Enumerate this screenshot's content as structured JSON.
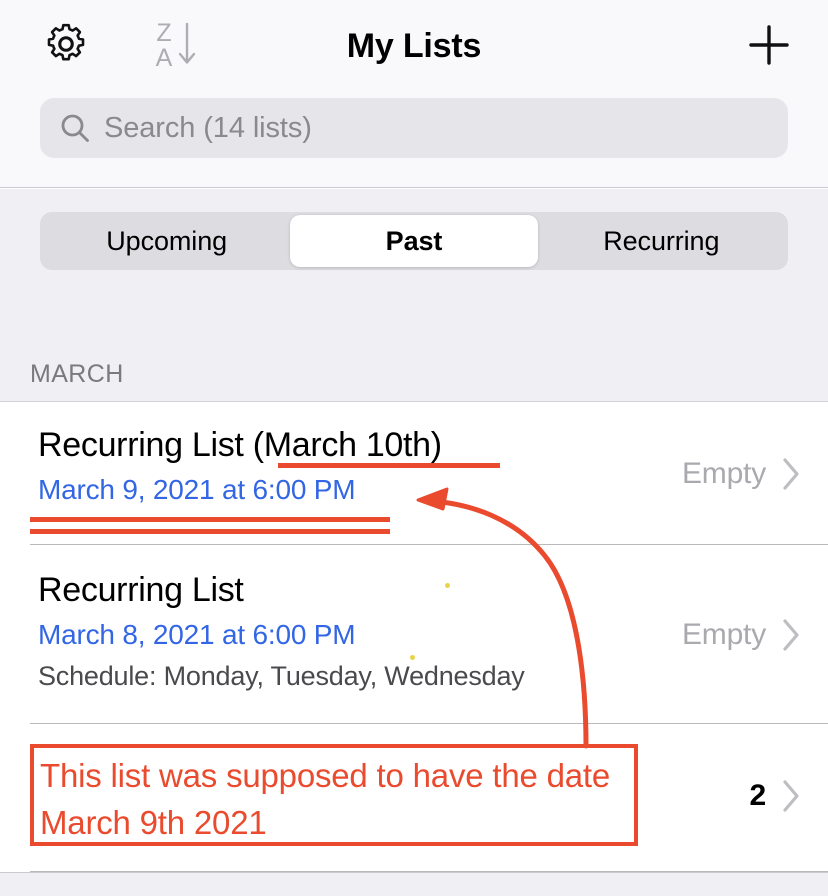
{
  "header": {
    "title": "My Lists",
    "settings_icon": "gear-icon",
    "sort_icon": "sort-z-a-descending-icon",
    "sort_top_letter": "Z",
    "sort_bottom_letter": "A",
    "add_icon": "plus-icon"
  },
  "search": {
    "icon": "search-icon",
    "placeholder": "Search (14 lists)",
    "value": ""
  },
  "tabs": {
    "items": [
      {
        "label": "Upcoming",
        "selected": false
      },
      {
        "label": "Past",
        "selected": true
      },
      {
        "label": "Recurring",
        "selected": false
      }
    ]
  },
  "section": {
    "label": "MARCH"
  },
  "rows": [
    {
      "title": "Recurring List (March 10th)",
      "date": "March 9, 2021 at 6:00 PM",
      "subtitle": "",
      "count": "Empty",
      "chevron": "chevron-right-icon"
    },
    {
      "title": "Recurring List",
      "date": "March 8, 2021 at 6:00 PM",
      "subtitle": "Schedule: Monday, Tuesday, Wednesday",
      "count": "Empty",
      "chevron": "chevron-right-icon"
    },
    {
      "title": "",
      "date": "",
      "subtitle": "",
      "count": "2",
      "chevron": "chevron-right-icon"
    }
  ],
  "annotation": {
    "callout_text": "This list was supposed to have the date March 9th 2021",
    "color": "#EA4A2D",
    "arrow_icon": "curved-arrow-icon"
  },
  "colors": {
    "accent_blue": "#3366E5",
    "annotation_red": "#EA4A2D",
    "background_gray": "#F0F0F4",
    "search_field": "#E6E6EA"
  }
}
